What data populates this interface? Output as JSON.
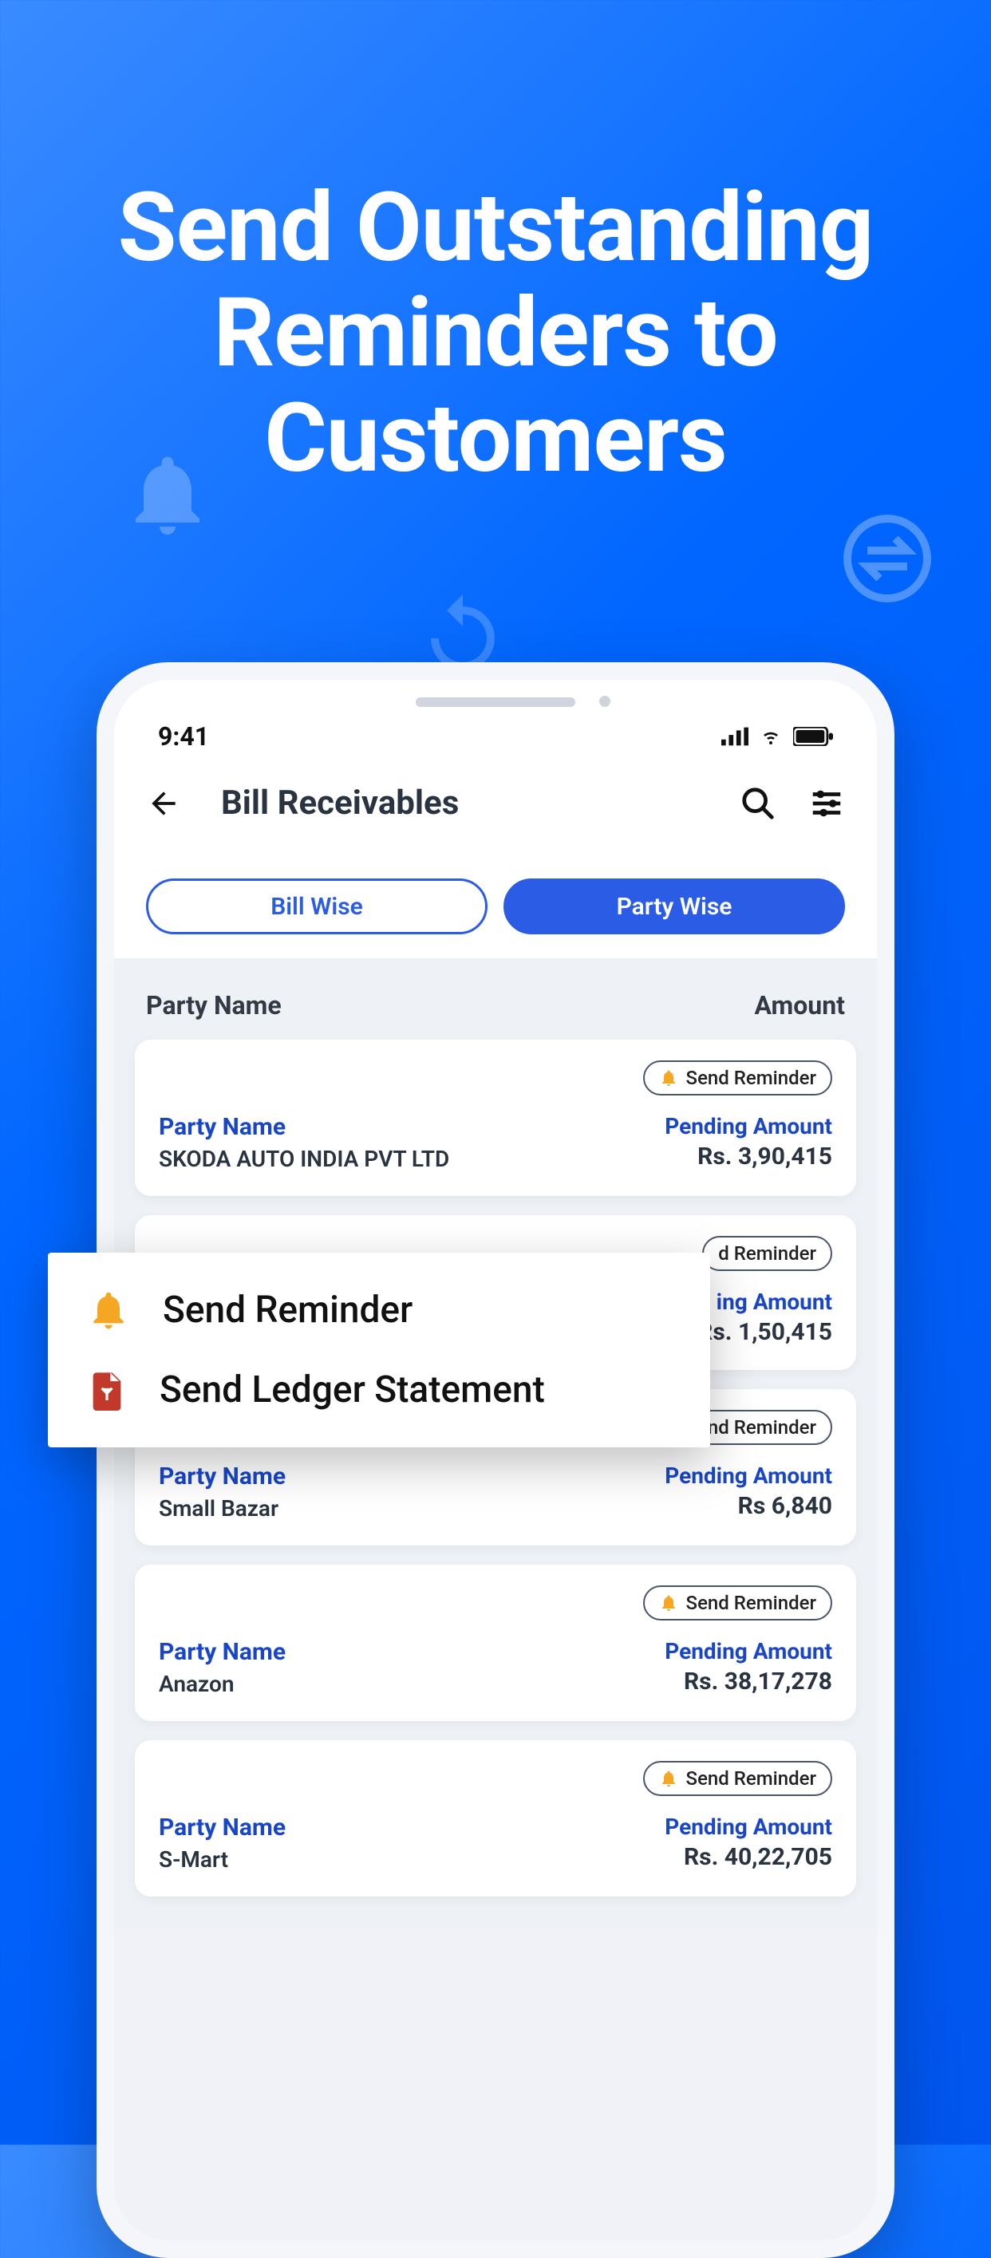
{
  "hero": {
    "title": "Send Outstanding Reminders to Customers"
  },
  "status": {
    "time": "9:41"
  },
  "header": {
    "title": "Bill Receivables"
  },
  "toggle": {
    "bill": "Bill Wise",
    "party": "Party Wise"
  },
  "columns": {
    "left": "Party Name",
    "right": "Amount"
  },
  "labels": {
    "party": "Party Name",
    "pending": "Pending Amount",
    "send_reminder": "Send Reminder"
  },
  "items": [
    {
      "name": "SKODA AUTO INDIA PVT LTD",
      "amount": "Rs. 3,90,415",
      "pending_label": "Pending Amount"
    },
    {
      "name": "",
      "amount": "Rs. 1,50,415",
      "pending_label": "ing Amount",
      "btn": "d Reminder"
    },
    {
      "name": "Small Bazar",
      "amount": "Rs 6,840",
      "pending_label": "Pending Amount"
    },
    {
      "name": "Anazon",
      "amount": "Rs. 38,17,278",
      "pending_label": "Pending Amount"
    },
    {
      "name": "S-Mart",
      "amount": "Rs. 40,22,705",
      "pending_label": "Pending Amount"
    }
  ],
  "popover": {
    "reminder": "Send Reminder",
    "ledger": "Send Ledger Statement"
  }
}
